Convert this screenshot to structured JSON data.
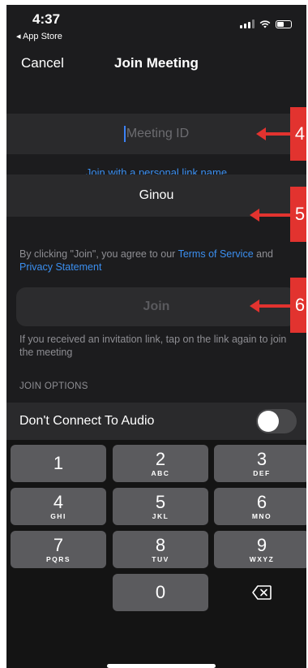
{
  "status_bar": {
    "time": "4:37",
    "back_label": "◂ App Store"
  },
  "nav": {
    "cancel_label": "Cancel",
    "title": "Join Meeting"
  },
  "meeting_id": {
    "placeholder": "Meeting ID"
  },
  "personal_link_label": "Join with a personal link name",
  "name_field": {
    "value": "Ginou"
  },
  "terms": {
    "prefix": "By clicking \"Join\", you agree to our ",
    "tos_link": "Terms of Service",
    "middle": " and ",
    "privacy_link": "Privacy Statement"
  },
  "join_button_label": "Join",
  "invite_note": "If you received an invitation link, tap on the link again to join the meeting",
  "join_options_header": "JOIN OPTIONS",
  "audio_option": {
    "label": "Don't Connect To Audio",
    "enabled": false
  },
  "keypad": {
    "keys": [
      {
        "num": "1",
        "letters": ""
      },
      {
        "num": "2",
        "letters": "ABC"
      },
      {
        "num": "3",
        "letters": "DEF"
      },
      {
        "num": "4",
        "letters": "GHI"
      },
      {
        "num": "5",
        "letters": "JKL"
      },
      {
        "num": "6",
        "letters": "MNO"
      },
      {
        "num": "7",
        "letters": "PQRS"
      },
      {
        "num": "8",
        "letters": "TUV"
      },
      {
        "num": "9",
        "letters": "WXYZ"
      },
      {
        "num": "0",
        "letters": ""
      }
    ],
    "delete_icon": "backspace-icon"
  },
  "annotations": [
    "4",
    "5",
    "6"
  ],
  "colors": {
    "accent": "#3b8ff0",
    "annotation": "#e2332f",
    "background": "#1c1c1e"
  }
}
